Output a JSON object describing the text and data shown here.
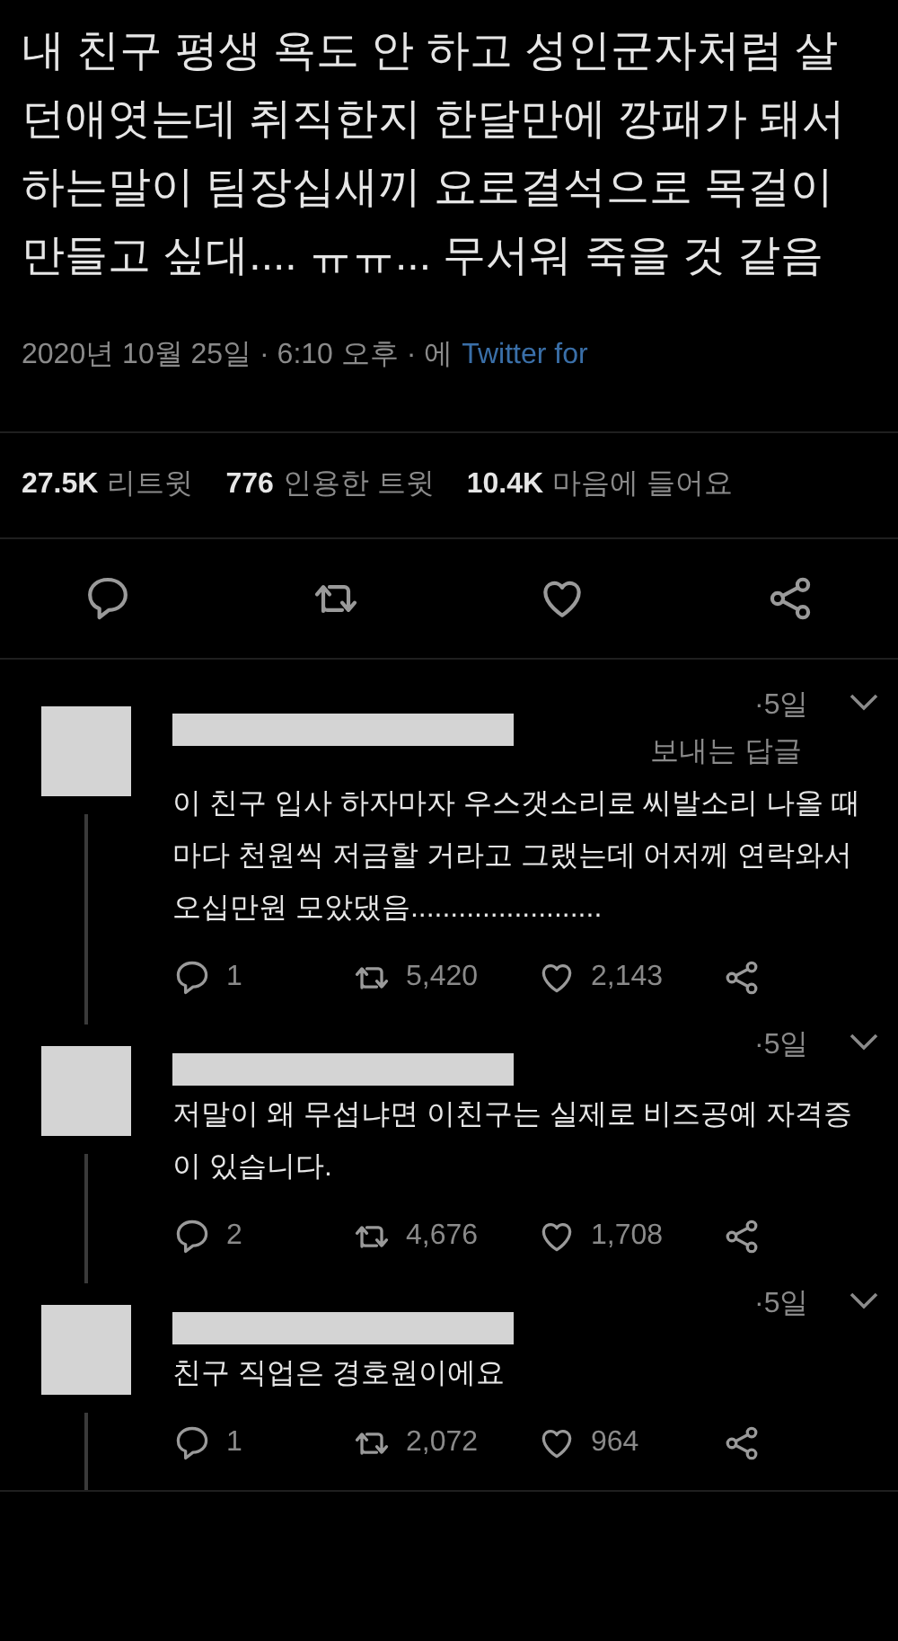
{
  "tweet": {
    "text": "내 친구 평생 욕도 안 하고 성인군자처럼 살던애엿는데 취직한지 한달만에 깡패가 돼서 하는말이 팀장십새끼 요로결석으로 목걸이 만들고 싶대.... ㅠㅠ... 무서워 죽을 것 같음",
    "timestamp": "2020년 10월 25일 · 6:10 오후 · 에",
    "source": "Twitter for",
    "stats": [
      {
        "count": "27.5K",
        "label": "리트윗"
      },
      {
        "count": "776",
        "label": "인용한 트윗"
      },
      {
        "count": "10.4K",
        "label": "마음에 들어요"
      }
    ]
  },
  "replies": [
    {
      "age": "·5일",
      "reply_label": "보내는 답글",
      "text": "이 친구 입사 하자마자 우스갯소리로 씨발소리 나올 때 마다 천원씩 저금할 거라고 그랬는데 어저께 연락와서 오십만원 모았댔음........................",
      "replies": "1",
      "retweets": "5,420",
      "likes": "2,143"
    },
    {
      "age": "·5일",
      "text": "저말이 왜 무섭냐면 이친구는 실제로 비즈공예 자격증이 있습니다.",
      "replies": "2",
      "retweets": "4,676",
      "likes": "1,708"
    },
    {
      "age": "·5일",
      "text": "친구 직업은 경호원이에요",
      "replies": "1",
      "retweets": "2,072",
      "likes": "964"
    }
  ]
}
